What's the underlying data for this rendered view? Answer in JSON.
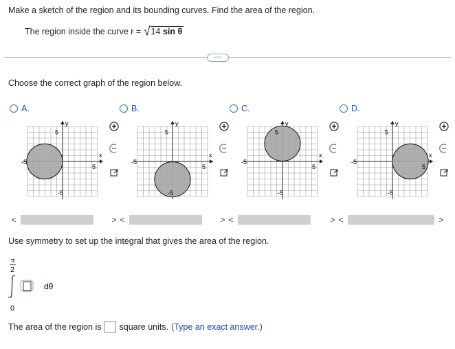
{
  "question": {
    "prompt": "Make a sketch of the region and its bounding curves. Find the area of the region.",
    "region_prefix": "The region inside the curve r =",
    "radicand_number": "14",
    "radicand_func": "sin θ"
  },
  "more_button": "⋯",
  "choose_text": "Choose the correct graph of the region below.",
  "options": [
    {
      "label": "A.",
      "shape": "left-disk"
    },
    {
      "label": "B.",
      "shape": "bottom-disk"
    },
    {
      "label": "C.",
      "shape": "top-disk"
    },
    {
      "label": "D.",
      "shape": "right-disk"
    }
  ],
  "graph_labels": {
    "y": "y",
    "x": "x",
    "pos5": "5",
    "neg5": "-5"
  },
  "tool_icons": [
    "zoom-in-icon",
    "zoom-out-icon",
    "expand-icon"
  ],
  "scroll_left": "<",
  "scroll_right": ">",
  "symmetry_text": "Use symmetry to set up the integral that gives the area of the region.",
  "integral": {
    "upper_num": "π",
    "upper_den": "2",
    "lower": "0",
    "differential": "dθ"
  },
  "area": {
    "prefix": "The area of the region is",
    "suffix": "square units.",
    "hint": "(Type an exact answer.)"
  }
}
